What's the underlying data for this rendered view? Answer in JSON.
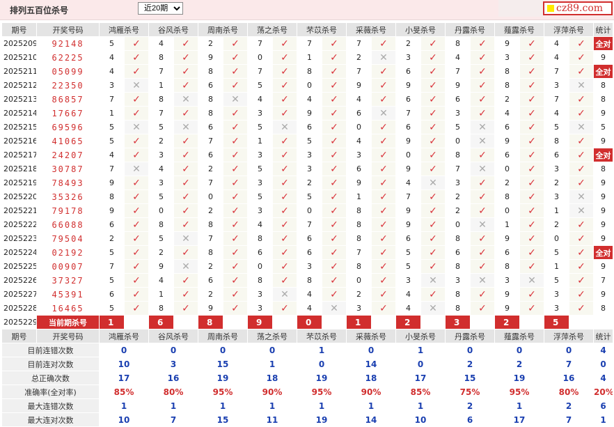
{
  "header": {
    "title": "排列五百位杀号",
    "period_select": "近20期",
    "logo_text": "cz89.com"
  },
  "columns": {
    "period": "期号",
    "draw": "开奖号码",
    "stat": "统计"
  },
  "methods": [
    "鸿雁杀号",
    "谷风杀号",
    "周南杀号",
    "荡之杀号",
    "芣苡杀号",
    "采薇杀号",
    "小旻杀号",
    "丹露杀号",
    "薤露杀号",
    "浮萍杀号"
  ],
  "rows": [
    {
      "period": "2025209",
      "draw": "92148",
      "nums": [
        5,
        4,
        2,
        7,
        7,
        7,
        2,
        8,
        9,
        4
      ],
      "hits": [
        1,
        1,
        1,
        1,
        1,
        1,
        1,
        1,
        1,
        1
      ],
      "stat": "全对"
    },
    {
      "period": "2025210",
      "draw": "62225",
      "nums": [
        4,
        8,
        9,
        0,
        1,
        2,
        3,
        4,
        3,
        4
      ],
      "hits": [
        1,
        1,
        1,
        1,
        1,
        0,
        1,
        1,
        1,
        1
      ],
      "stat": "9"
    },
    {
      "period": "2025211",
      "draw": "05099",
      "nums": [
        4,
        7,
        8,
        7,
        8,
        7,
        6,
        7,
        8,
        7
      ],
      "hits": [
        1,
        1,
        1,
        1,
        1,
        1,
        1,
        1,
        1,
        1
      ],
      "stat": "全对"
    },
    {
      "period": "2025212",
      "draw": "22350",
      "nums": [
        3,
        1,
        6,
        5,
        0,
        9,
        9,
        9,
        8,
        3
      ],
      "hits": [
        0,
        1,
        1,
        1,
        1,
        1,
        1,
        1,
        1,
        0
      ],
      "stat": "8"
    },
    {
      "period": "2025213",
      "draw": "86857",
      "nums": [
        7,
        8,
        8,
        4,
        4,
        4,
        6,
        6,
        2,
        7
      ],
      "hits": [
        1,
        0,
        0,
        1,
        1,
        1,
        1,
        1,
        1,
        1
      ],
      "stat": "8"
    },
    {
      "period": "2025214",
      "draw": "17667",
      "nums": [
        1,
        7,
        8,
        3,
        9,
        6,
        7,
        3,
        4,
        4
      ],
      "hits": [
        1,
        1,
        1,
        1,
        1,
        0,
        1,
        1,
        1,
        1
      ],
      "stat": "9"
    },
    {
      "period": "2025215",
      "draw": "69596",
      "nums": [
        5,
        5,
        6,
        5,
        6,
        0,
        6,
        5,
        6,
        5
      ],
      "hits": [
        0,
        0,
        1,
        0,
        1,
        1,
        1,
        0,
        1,
        0
      ],
      "stat": "5"
    },
    {
      "period": "2025216",
      "draw": "41065",
      "nums": [
        5,
        2,
        7,
        1,
        5,
        4,
        9,
        0,
        9,
        8
      ],
      "hits": [
        1,
        1,
        1,
        1,
        1,
        1,
        1,
        0,
        1,
        1
      ],
      "stat": "9"
    },
    {
      "period": "2025217",
      "draw": "24207",
      "nums": [
        4,
        3,
        6,
        3,
        3,
        3,
        0,
        8,
        6,
        6
      ],
      "hits": [
        1,
        1,
        1,
        1,
        1,
        1,
        1,
        1,
        1,
        1
      ],
      "stat": "全对"
    },
    {
      "period": "2025218",
      "draw": "30787",
      "nums": [
        7,
        4,
        2,
        5,
        3,
        6,
        9,
        7,
        0,
        3
      ],
      "hits": [
        0,
        1,
        1,
        1,
        1,
        1,
        1,
        0,
        1,
        1
      ],
      "stat": "8"
    },
    {
      "period": "2025219",
      "draw": "78493",
      "nums": [
        9,
        3,
        7,
        3,
        2,
        9,
        4,
        3,
        2,
        2
      ],
      "hits": [
        1,
        1,
        1,
        1,
        1,
        1,
        0,
        1,
        1,
        1
      ],
      "stat": "9"
    },
    {
      "period": "2025220",
      "draw": "35326",
      "nums": [
        8,
        5,
        0,
        5,
        5,
        1,
        7,
        2,
        8,
        3
      ],
      "hits": [
        1,
        1,
        1,
        1,
        1,
        1,
        1,
        1,
        1,
        0
      ],
      "stat": "9"
    },
    {
      "period": "2025221",
      "draw": "79178",
      "nums": [
        9,
        0,
        2,
        3,
        0,
        8,
        9,
        2,
        0,
        1
      ],
      "hits": [
        1,
        1,
        1,
        1,
        1,
        1,
        1,
        1,
        1,
        0
      ],
      "stat": "9"
    },
    {
      "period": "2025222",
      "draw": "66088",
      "nums": [
        6,
        8,
        8,
        4,
        7,
        8,
        9,
        0,
        1,
        2
      ],
      "hits": [
        1,
        1,
        1,
        1,
        1,
        1,
        1,
        0,
        1,
        1
      ],
      "stat": "9"
    },
    {
      "period": "2025223",
      "draw": "79504",
      "nums": [
        2,
        5,
        7,
        8,
        6,
        8,
        6,
        8,
        9,
        0
      ],
      "hits": [
        1,
        0,
        1,
        1,
        1,
        1,
        1,
        1,
        1,
        1
      ],
      "stat": "9"
    },
    {
      "period": "2025224",
      "draw": "02192",
      "nums": [
        5,
        2,
        8,
        6,
        6,
        7,
        5,
        6,
        6,
        5
      ],
      "hits": [
        1,
        1,
        1,
        1,
        1,
        1,
        1,
        1,
        1,
        1
      ],
      "stat": "全对"
    },
    {
      "period": "2025225",
      "draw": "00907",
      "nums": [
        7,
        9,
        2,
        0,
        3,
        8,
        5,
        8,
        8,
        1
      ],
      "hits": [
        1,
        0,
        1,
        1,
        1,
        1,
        1,
        1,
        1,
        1
      ],
      "stat": "9"
    },
    {
      "period": "2025226",
      "draw": "37327",
      "nums": [
        5,
        4,
        6,
        8,
        8,
        0,
        3,
        3,
        3,
        5
      ],
      "hits": [
        1,
        1,
        1,
        1,
        1,
        1,
        0,
        0,
        0,
        1
      ],
      "stat": "7"
    },
    {
      "period": "2025227",
      "draw": "45391",
      "nums": [
        6,
        1,
        2,
        3,
        4,
        2,
        4,
        8,
        9,
        3
      ],
      "hits": [
        1,
        1,
        1,
        0,
        1,
        1,
        1,
        1,
        1,
        1
      ],
      "stat": "9"
    },
    {
      "period": "2025228",
      "draw": "16465",
      "nums": [
        5,
        8,
        9,
        3,
        4,
        3,
        4,
        8,
        9,
        3
      ],
      "hits": [
        1,
        1,
        1,
        1,
        0,
        1,
        0,
        1,
        1,
        1
      ],
      "stat": "8"
    }
  ],
  "current": {
    "period": "2025229",
    "label": "当前期杀号",
    "nums": [
      "1",
      "6",
      "8",
      "9",
      "0",
      "1",
      "2",
      "3",
      "2",
      "5"
    ]
  },
  "summary": [
    {
      "label": "目前连错次数",
      "vals": [
        "0",
        "0",
        "0",
        "0",
        "1",
        "0",
        "1",
        "0",
        "0",
        "0"
      ],
      "stat": "4",
      "pct": false
    },
    {
      "label": "目前连对次数",
      "vals": [
        "10",
        "3",
        "15",
        "1",
        "0",
        "14",
        "0",
        "2",
        "2",
        "7"
      ],
      "stat": "0",
      "pct": false
    },
    {
      "label": "总正确次数",
      "vals": [
        "17",
        "16",
        "19",
        "18",
        "19",
        "18",
        "17",
        "15",
        "19",
        "16"
      ],
      "stat": "4",
      "pct": false
    },
    {
      "label": "准确率(全对率)",
      "vals": [
        "85%",
        "80%",
        "95%",
        "90%",
        "95%",
        "90%",
        "85%",
        "75%",
        "95%",
        "80%"
      ],
      "stat": "20%",
      "pct": true
    },
    {
      "label": "最大连错次数",
      "vals": [
        "1",
        "1",
        "1",
        "1",
        "1",
        "1",
        "1",
        "2",
        "1",
        "2"
      ],
      "stat": "6",
      "pct": false
    },
    {
      "label": "最大连对次数",
      "vals": [
        "10",
        "7",
        "15",
        "11",
        "19",
        "14",
        "10",
        "6",
        "17",
        "7"
      ],
      "stat": "1",
      "pct": false
    }
  ],
  "symbols": {
    "hit": "✓",
    "miss": "✕"
  },
  "colors": {
    "accent": "#d12e2e",
    "value_blue": "#1a3fb0",
    "header_bg": "#e4e4e4",
    "top_bg": "#fbe9ea"
  }
}
